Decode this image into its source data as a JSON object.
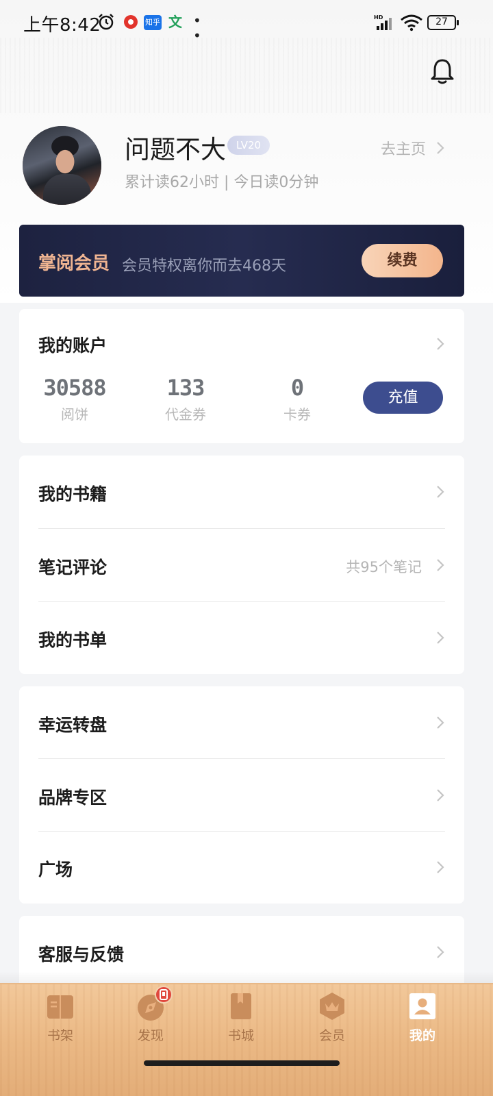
{
  "status_bar": {
    "time": "上午8:42",
    "app_zhihu": "知乎",
    "app_wen": "文",
    "more": "• •",
    "battery": "27"
  },
  "profile": {
    "username": "问题不大",
    "level": "LV20",
    "homepage_link": "去主页",
    "read_stats": "累计读62小时 | 今日读0分钟"
  },
  "membership": {
    "title": "掌阅会员",
    "description": "会员特权离你而去468天",
    "renew_label": "续费"
  },
  "account": {
    "title": "我的账户",
    "stats": [
      {
        "value": "30588",
        "label": "阅饼"
      },
      {
        "value": "133",
        "label": "代金券"
      },
      {
        "value": "0",
        "label": "卡券"
      }
    ],
    "topup_label": "充值"
  },
  "books_section": [
    {
      "label": "我的书籍",
      "extra": ""
    },
    {
      "label": "笔记评论",
      "extra": "共95个笔记"
    },
    {
      "label": "我的书单",
      "extra": ""
    }
  ],
  "features_section": [
    {
      "label": "幸运转盘"
    },
    {
      "label": "品牌专区"
    },
    {
      "label": "广场"
    }
  ],
  "service_section": [
    {
      "label": "客服与反馈"
    }
  ],
  "bottom_nav": [
    {
      "label": "书架",
      "icon": "bookshelf-icon"
    },
    {
      "label": "发现",
      "icon": "compass-icon"
    },
    {
      "label": "书城",
      "icon": "bookstore-icon"
    },
    {
      "label": "会员",
      "icon": "crown-icon"
    },
    {
      "label": "我的",
      "icon": "profile-icon",
      "active": true
    }
  ],
  "colors": {
    "member_banner": "#1d2240",
    "member_title": "#f0b592",
    "topup_button": "#3d4d8f",
    "nav_wood": "#ebb985"
  }
}
